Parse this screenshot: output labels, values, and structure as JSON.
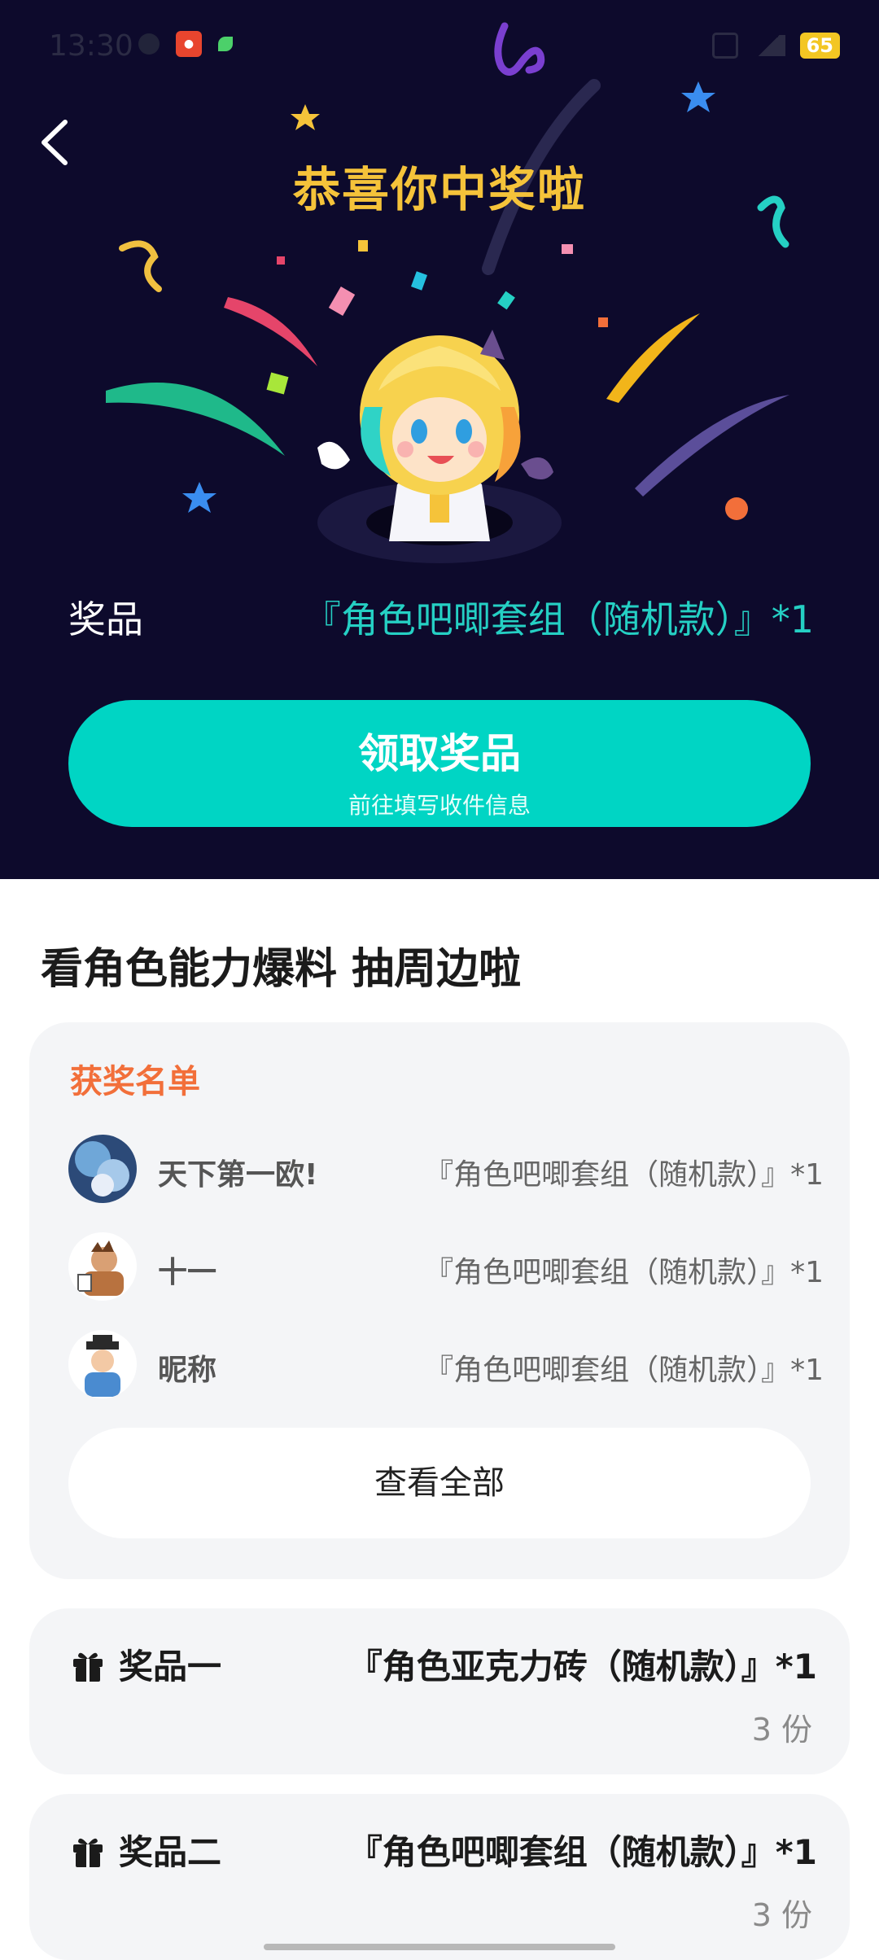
{
  "status_bar": {
    "time": "13:30",
    "battery": "65"
  },
  "hero": {
    "title": "恭喜你中奖啦",
    "prize_label": "奖品",
    "prize_value": "『角色吧唧套组（随机款）』*1",
    "claim_button": {
      "label": "领取奖品",
      "sublabel": "前往填写收件信息"
    }
  },
  "section_title": "看角色能力爆料 抽周边啦",
  "winners": {
    "title": "获奖名单",
    "rows": [
      {
        "name": "天下第一欧!",
        "prize": "『角色吧唧套组（随机款）』*1"
      },
      {
        "name": "十一",
        "prize": "『角色吧唧套组（随机款）』*1"
      },
      {
        "name": "昵称",
        "prize": "『角色吧唧套组（随机款）』*1"
      }
    ],
    "view_all": "查看全部"
  },
  "prizes": [
    {
      "name": "奖品一",
      "item": "『角色亚克力砖（随机款）』*1",
      "count": "3 份"
    },
    {
      "name": "奖品二",
      "item": "『角色吧唧套组（随机款）』*1",
      "count": "3 份"
    }
  ],
  "colors": {
    "hero_bg": "#0d0a2c",
    "accent_teal": "#00d5c4",
    "title_gold": "#f5c33a",
    "winners_orange": "#f26f3a"
  }
}
